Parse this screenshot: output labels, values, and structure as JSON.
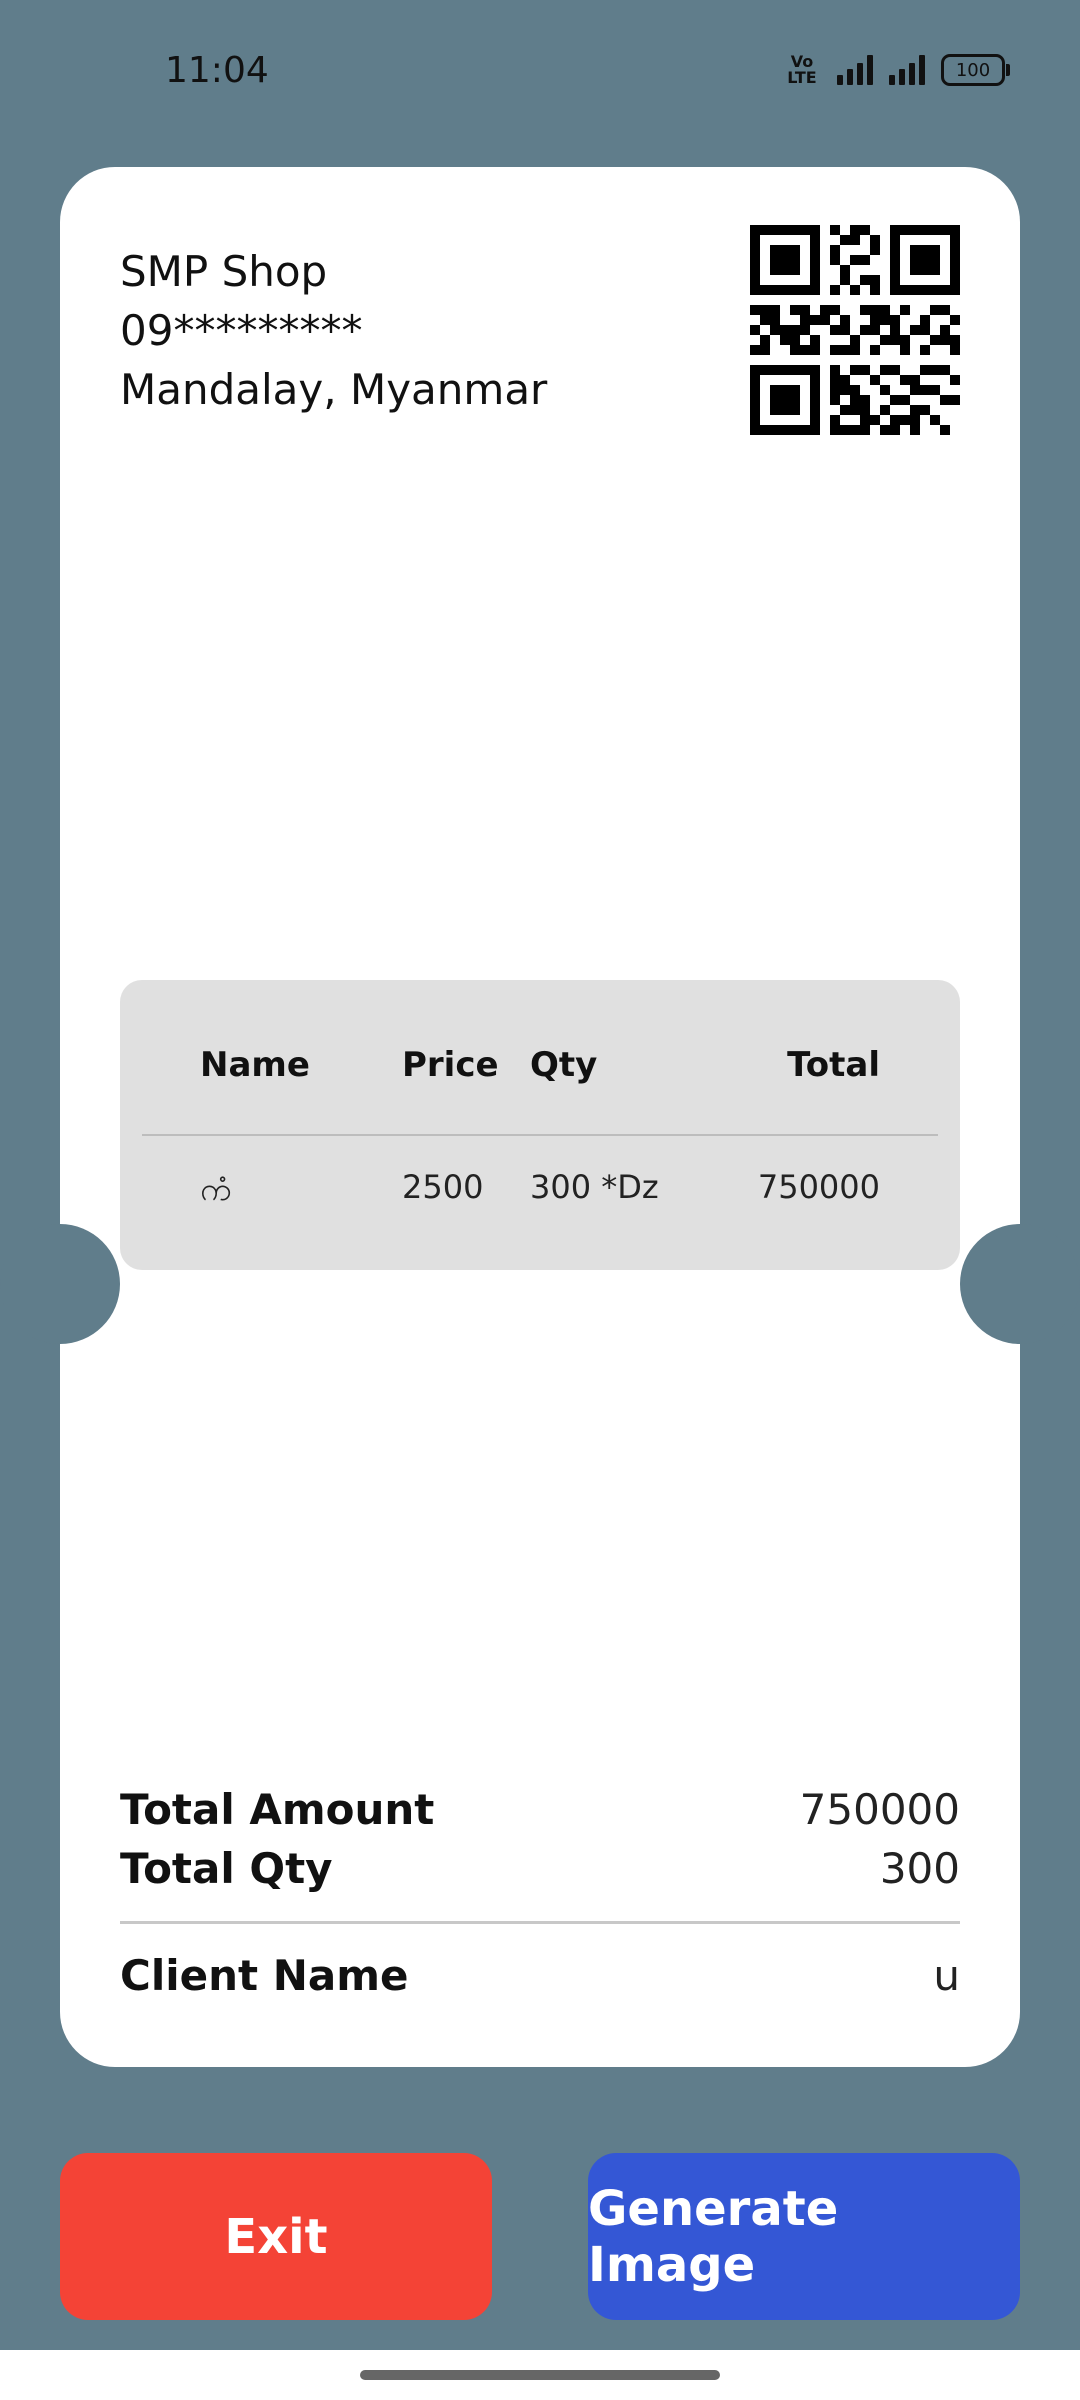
{
  "status_bar": {
    "time": "11:04",
    "network_label": "VoLTE",
    "battery": "100",
    "icons": [
      "volte-icon",
      "signal-icon",
      "signal-icon",
      "battery-icon"
    ]
  },
  "receipt": {
    "shop": {
      "name": "SMP Shop",
      "phone": "09*********",
      "address": "Mandalay, Myanmar"
    },
    "qr_icon": "qr-code-icon",
    "table": {
      "headers": {
        "name": "Name",
        "price": "Price",
        "qty": "Qty",
        "total": "Total"
      },
      "rows": [
        {
          "name": "ကံ",
          "price": "2500",
          "qty": "300 *Dz",
          "total": "750000"
        }
      ]
    },
    "summary": {
      "total_amount_label": "Total Amount",
      "total_amount": "750000",
      "total_qty_label": "Total Qty",
      "total_qty": "300",
      "client_name_label": "Client Name",
      "client_name": "u"
    }
  },
  "actions": {
    "exit_label": "Exit",
    "generate_label": "Generate Image"
  },
  "colors": {
    "background": "#607d8b",
    "card": "#ffffff",
    "table_bg": "#e0e0e0",
    "exit_button": "#f44336",
    "generate_button": "#3457d5"
  }
}
